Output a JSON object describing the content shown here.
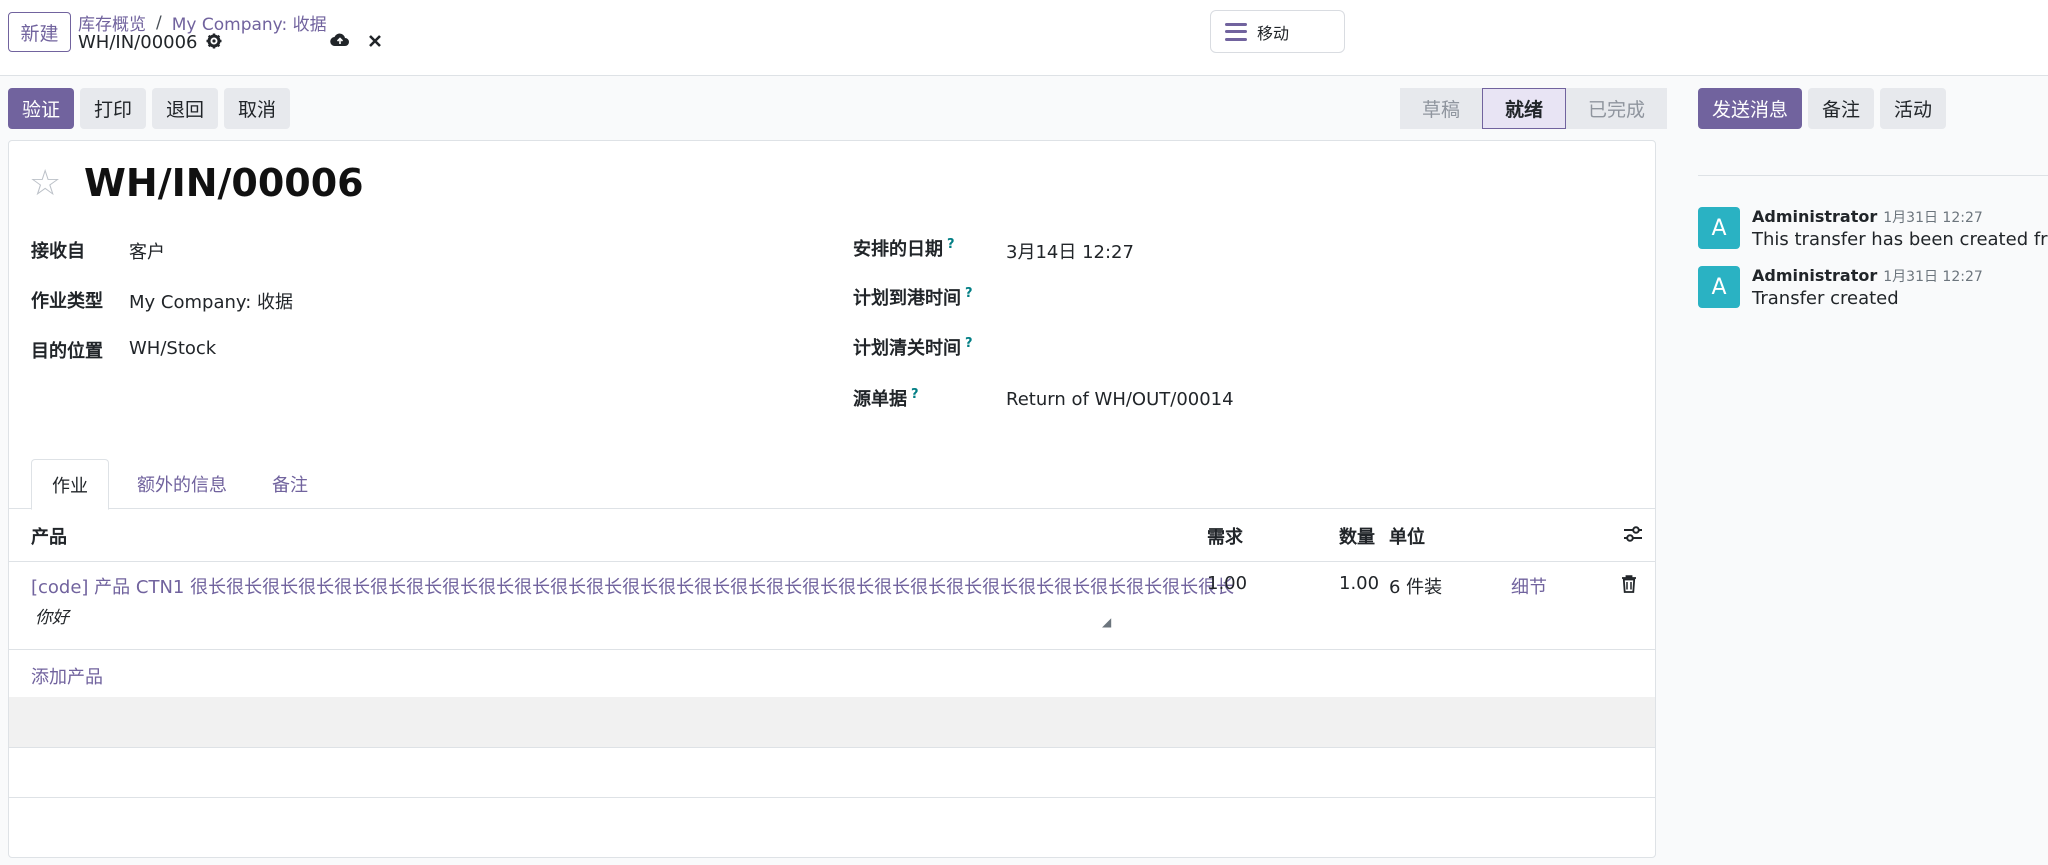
{
  "control_panel": {
    "new_button": "新建",
    "breadcrumb": [
      "库存概览",
      "My Company: 收据"
    ],
    "breadcrumb_separator": "/",
    "record_name": "WH/IN/00006",
    "move_button": "移动"
  },
  "actions": {
    "validate": "验证",
    "print": "打印",
    "return": "退回",
    "cancel": "取消"
  },
  "statusbar": {
    "stages": [
      "草稿",
      "就绪",
      "已完成"
    ],
    "current": "就绪"
  },
  "form": {
    "title": "WH/IN/00006",
    "left_fields": [
      {
        "label": "接收自",
        "value": "客户"
      },
      {
        "label": "作业类型",
        "value": "My Company: 收据"
      },
      {
        "label": "目的位置",
        "value": "WH/Stock"
      }
    ],
    "right_fields": [
      {
        "label": "安排的日期",
        "value": "3月14日 12:27"
      },
      {
        "label": "计划到港时间",
        "value": ""
      },
      {
        "label": "计划清关时间",
        "value": ""
      },
      {
        "label": "源单据",
        "value": "Return of WH/OUT/00014"
      }
    ],
    "help_mark": "?"
  },
  "tabs": [
    "作业",
    "额外的信息",
    "备注"
  ],
  "table": {
    "headers": {
      "product": "产品",
      "demand": "需求",
      "quantity": "数量",
      "uom": "单位"
    },
    "rows": [
      {
        "product": "[code] 产品 CTN1 很长很长很长很长很长很长很长很长很长很长很长很长很长很长很长很长很长很长很长很长很长很长很长很长很长很长很长很长很长",
        "description": "你好",
        "demand": "1.00",
        "quantity": "1.00",
        "uom": "6 件装",
        "details": "细节"
      }
    ],
    "add_line": "添加产品"
  },
  "chatter": {
    "send_message": "发送消息",
    "log_note": "备注",
    "activity": "活动",
    "messages": [
      {
        "avatar": "A",
        "author": "Administrator",
        "date": "1月31日 12:27",
        "body": "This transfer has been created from"
      },
      {
        "avatar": "A",
        "author": "Administrator",
        "date": "1月31日 12:27",
        "body": "Transfer created"
      }
    ]
  },
  "colors": {
    "primary": "#71639e",
    "avatar": "#2ab2c3"
  }
}
